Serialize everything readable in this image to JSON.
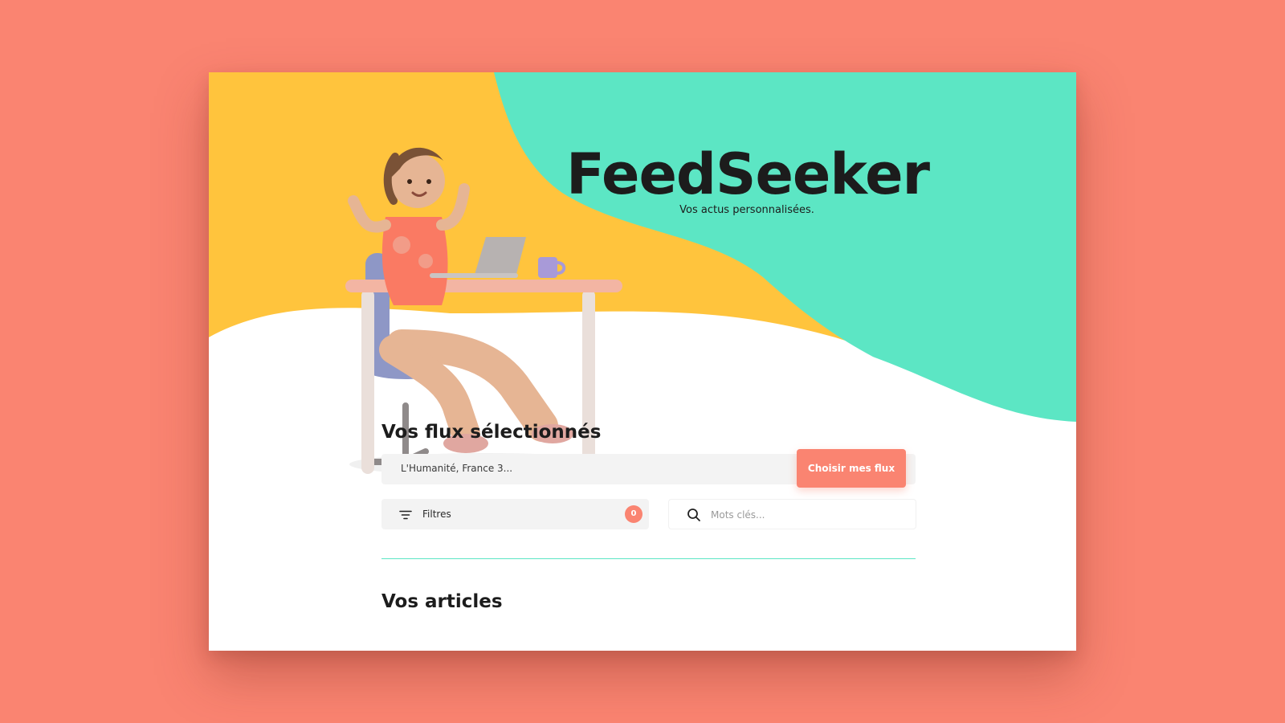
{
  "brand": {
    "title": "FeedSeeker",
    "tagline": "Vos actus personnalisées."
  },
  "feeds": {
    "heading": "Vos flux sélectionnés",
    "selected_value": "L'Humanité, France 3...",
    "choose_button": "Choisir mes flux"
  },
  "filters": {
    "label": "Filtres",
    "count": "0"
  },
  "search": {
    "placeholder": "Mots clés..."
  },
  "articles": {
    "heading": "Vos articles"
  },
  "colors": {
    "background": "#FA8471",
    "accent_coral": "#FA8471",
    "hero_yellow": "#FFC43D",
    "hero_mint": "#5CE6C4"
  },
  "icons": [
    "filter-icon",
    "search-icon"
  ]
}
